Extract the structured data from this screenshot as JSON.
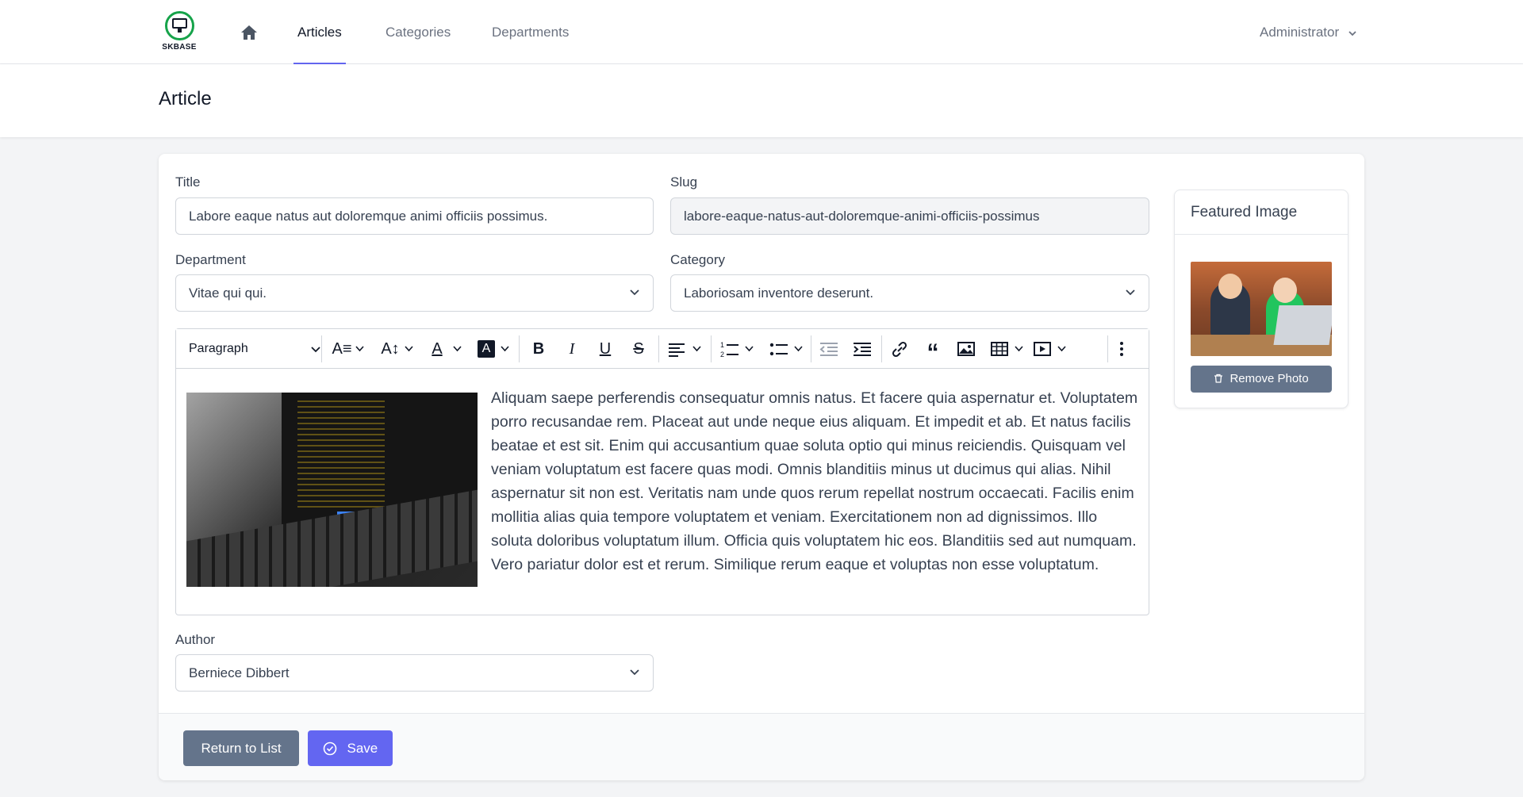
{
  "app": {
    "logo_text": "SKBASE"
  },
  "nav": {
    "items": [
      {
        "label": "Articles"
      },
      {
        "label": "Categories"
      },
      {
        "label": "Departments"
      }
    ],
    "user_label": "Administrator"
  },
  "page": {
    "title": "Article"
  },
  "form": {
    "title_label": "Title",
    "title_value": "Labore eaque natus aut doloremque animi officiis possimus.",
    "slug_label": "Slug",
    "slug_value": "labore-eaque-natus-aut-doloremque-animi-officiis-possimus",
    "department_label": "Department",
    "department_value": "Vitae qui qui.",
    "category_label": "Category",
    "category_value": "Laboriosam inventore deserunt.",
    "author_label": "Author",
    "author_value": "Berniece Dibbert"
  },
  "editor": {
    "block_format": "Paragraph",
    "toolbar_icons": [
      "font-size-icon",
      "font-family-icon",
      "font-color-icon",
      "font-background-icon",
      "bold-icon",
      "italic-icon",
      "underline-icon",
      "strikethrough-icon",
      "align-icon",
      "numbered-list-icon",
      "bulleted-list-icon",
      "outdent-icon",
      "indent-icon",
      "link-icon",
      "blockquote-icon",
      "insert-image-icon",
      "insert-table-icon",
      "insert-media-icon",
      "more-icon"
    ],
    "content": "Aliquam saepe perferendis consequatur omnis natus. Et facere quia aspernatur et. Voluptatem porro recusandae rem. Placeat aut unde neque eius aliquam. Et impedit et ab. Et natus facilis beatae et est sit. Enim qui accusantium quae soluta optio qui minus reiciendis. Quisquam vel veniam voluptatum est facere quas modi. Omnis blanditiis minus ut ducimus qui alias. Nihil aspernatur sit non est. Veritatis nam unde quos rerum repellat nostrum occaecati. Facilis enim mollitia alias quia tempore voluptatem et veniam. Exercitationem non ad dignissimos. Illo soluta doloribus voluptatum illum. Officia quis voluptatem hic eos. Blanditiis sed aut numquam. Vero pariatur dolor est et rerum. Similique rerum eaque et voluptas non esse voluptatum."
  },
  "featured": {
    "heading": "Featured Image",
    "remove_label": "Remove Photo"
  },
  "actions": {
    "return_label": "Return to List",
    "save_label": "Save"
  },
  "colors": {
    "accent": "#6366f1",
    "secondary_button": "#64748b",
    "logo_green": "#16a34a"
  }
}
